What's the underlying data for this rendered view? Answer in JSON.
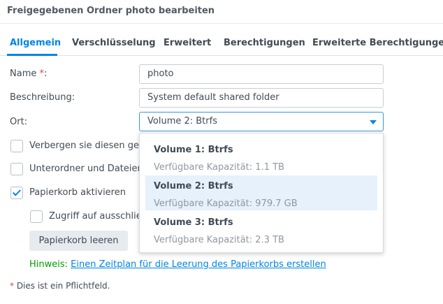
{
  "window": {
    "title": "Freigegebenen Ordner photo bearbeiten"
  },
  "tabs": [
    {
      "label": "Allgemein",
      "active": true
    },
    {
      "label": "Verschlüsselung",
      "active": false
    },
    {
      "label": "Erweitert",
      "active": false
    },
    {
      "label": "Berechtigungen",
      "active": false
    },
    {
      "label": "Erweiterte Berechtigungen",
      "active": false
    }
  ],
  "form": {
    "name_label": "Name",
    "required_marker": "*",
    "name_colon": ":",
    "name_value": "photo",
    "description_label": "Beschreibung:",
    "description_value": "System default shared folder",
    "location_label": "Ort:",
    "location_value": "Volume 2:  Btrfs"
  },
  "checkboxes": {
    "hide": {
      "label": "Verbergen sie diesen ge",
      "checked": false
    },
    "subfolders": {
      "label": "Unterordner und Dateien",
      "checked": false
    },
    "recycle_bin": {
      "label": "Papierkorb aktivieren",
      "checked": true
    },
    "restrict_access": {
      "label": "Zugriff auf ausschlie",
      "checked": false
    }
  },
  "buttons": {
    "empty_recycle_bin": "Papierkorb leeren"
  },
  "hint": {
    "prefix": "Hinweis:",
    "link": "Einen Zeitplan für die Leerung des Papierkorbs erstellen"
  },
  "footnote": {
    "marker": "*",
    "text": " Dies ist ein Pflichtfeld."
  },
  "dropdown": {
    "options": [
      {
        "name": "Volume 1: Btrfs",
        "capacity": "Verfügbare Kapazität: 1.1 TB",
        "selected": false
      },
      {
        "name": "Volume 2: Btrfs",
        "capacity": "Verfügbare Kapazität: 979.7 GB",
        "selected": true
      },
      {
        "name": "Volume 3: Btrfs",
        "capacity": "Verfügbare Kapazität: 2.3 TB",
        "selected": false
      }
    ]
  },
  "colors": {
    "accent": "#0086e5",
    "required": "#e64040",
    "hint": "#00a000",
    "selected_option": "#e6f1fc"
  },
  "icons": {
    "location_dropdown": "caret-down-icon",
    "checked": "checkmark-icon"
  }
}
